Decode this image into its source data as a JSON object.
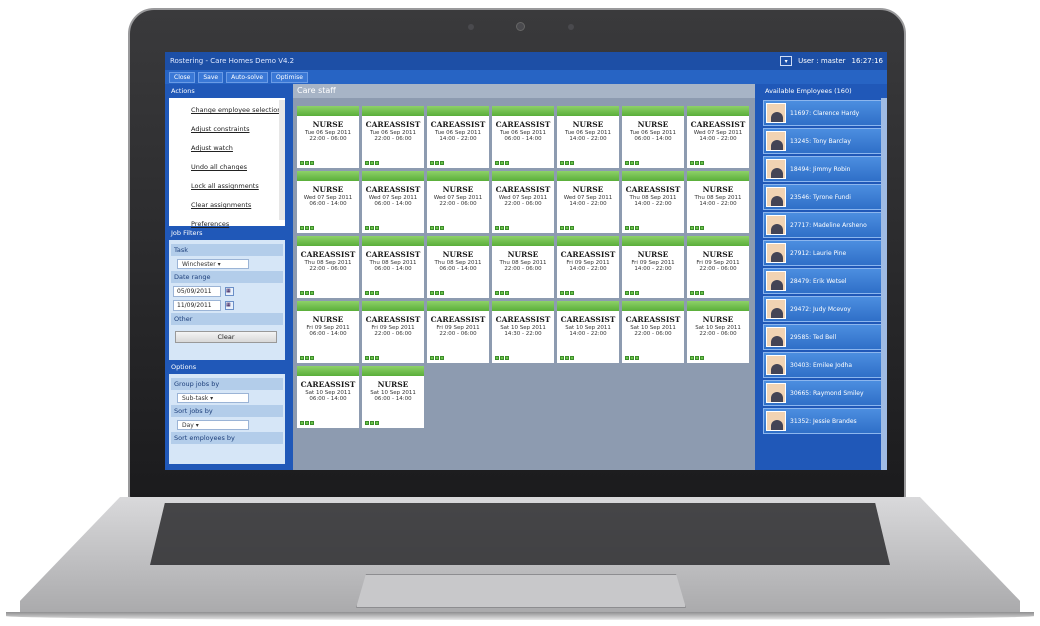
{
  "app": {
    "title": "Rostering - Care Homes Demo V4.2",
    "user": "User : master",
    "clock": "16:27:16"
  },
  "toolbar": [
    "Close",
    "Save",
    "Auto-solve",
    "Optimise"
  ],
  "actions": {
    "title": "Actions",
    "items": [
      "Change employee selection",
      "Adjust constraints",
      "Adjust watch",
      "Undo all changes",
      "Lock all assignments",
      "Clear assignments",
      "Preferences"
    ]
  },
  "filters": {
    "title": "Job Filters",
    "task_label": "Task",
    "task_value": "Winchester",
    "date_label": "Date range",
    "date_from": "05/09/2011",
    "date_to": "11/09/2011",
    "other_label": "Other",
    "clear_label": "Clear"
  },
  "options": {
    "title": "Options",
    "group_label": "Group jobs by",
    "group_value": "Sub-task",
    "sort_jobs_label": "Sort jobs by",
    "sort_jobs_value": "Day",
    "sort_emp_label": "Sort employees by"
  },
  "main": {
    "title": "Care staff",
    "cards": [
      {
        "role": "NURSE",
        "date": "Tue 06 Sep 2011",
        "time": "22:00 - 06:00"
      },
      {
        "role": "CAREASSIST",
        "date": "Tue 06 Sep 2011",
        "time": "22:00 - 06:00"
      },
      {
        "role": "CAREASSIST",
        "date": "Tue 06 Sep 2011",
        "time": "14:00 - 22:00"
      },
      {
        "role": "CAREASSIST",
        "date": "Tue 06 Sep 2011",
        "time": "06:00 - 14:00"
      },
      {
        "role": "NURSE",
        "date": "Tue 06 Sep 2011",
        "time": "14:00 - 22:00"
      },
      {
        "role": "NURSE",
        "date": "Tue 06 Sep 2011",
        "time": "06:00 - 14:00"
      },
      {
        "role": "CAREASSIST",
        "date": "Wed 07 Sep 2011",
        "time": "14:00 - 22:00"
      },
      {
        "role": "NURSE",
        "date": "Wed 07 Sep 2011",
        "time": "06:00 - 14:00"
      },
      {
        "role": "CAREASSIST",
        "date": "Wed 07 Sep 2011",
        "time": "06:00 - 14:00"
      },
      {
        "role": "NURSE",
        "date": "Wed 07 Sep 2011",
        "time": "22:00 - 06:00"
      },
      {
        "role": "CAREASSIST",
        "date": "Wed 07 Sep 2011",
        "time": "22:00 - 06:00"
      },
      {
        "role": "NURSE",
        "date": "Wed 07 Sep 2011",
        "time": "14:00 - 22:00"
      },
      {
        "role": "CAREASSIST",
        "date": "Thu 08 Sep 2011",
        "time": "14:00 - 22:00"
      },
      {
        "role": "NURSE",
        "date": "Thu 08 Sep 2011",
        "time": "14:00 - 22:00"
      },
      {
        "role": "CAREASSIST",
        "date": "Thu 08 Sep 2011",
        "time": "22:00 - 06:00"
      },
      {
        "role": "CAREASSIST",
        "date": "Thu 08 Sep 2011",
        "time": "06:00 - 14:00"
      },
      {
        "role": "NURSE",
        "date": "Thu 08 Sep 2011",
        "time": "06:00 - 14:00"
      },
      {
        "role": "NURSE",
        "date": "Thu 08 Sep 2011",
        "time": "22:00 - 06:00"
      },
      {
        "role": "CAREASSIST",
        "date": "Fri 09 Sep 2011",
        "time": "14:00 - 22:00"
      },
      {
        "role": "NURSE",
        "date": "Fri 09 Sep 2011",
        "time": "14:00 - 22:00"
      },
      {
        "role": "NURSE",
        "date": "Fri 09 Sep 2011",
        "time": "22:00 - 06:00"
      },
      {
        "role": "NURSE",
        "date": "Fri 09 Sep 2011",
        "time": "06:00 - 14:00"
      },
      {
        "role": "CAREASSIST",
        "date": "Fri 09 Sep 2011",
        "time": "22:00 - 06:00"
      },
      {
        "role": "CAREASSIST",
        "date": "Fri 09 Sep 2011",
        "time": "22:00 - 06:00"
      },
      {
        "role": "CAREASSIST",
        "date": "Sat 10 Sep 2011",
        "time": "14:30 - 22:00"
      },
      {
        "role": "CAREASSIST",
        "date": "Sat 10 Sep 2011",
        "time": "14:00 - 22:00"
      },
      {
        "role": "CAREASSIST",
        "date": "Sat 10 Sep 2011",
        "time": "22:00 - 06:00"
      },
      {
        "role": "NURSE",
        "date": "Sat 10 Sep 2011",
        "time": "22:00 - 06:00"
      },
      {
        "role": "CAREASSIST",
        "date": "Sat 10 Sep 2011",
        "time": "06:00 - 14:00"
      },
      {
        "role": "NURSE",
        "date": "Sat 10 Sep 2011",
        "time": "06:00 - 14:00"
      }
    ]
  },
  "employees": {
    "title": "Available Employees (160)",
    "items": [
      "11697: Clarence Hardy",
      "13245: Tony Barclay",
      "18494: Jimmy Robin",
      "23546: Tyrone Fundi",
      "27717: Madeline Arsheno",
      "27912: Laurie Pine",
      "28479: Erik Wetsel",
      "29472: Judy Mcevoy",
      "29585: Ted Bell",
      "30403: Emilee Jodha",
      "30665: Raymond Smiley",
      "31352: Jessie Brandes"
    ]
  }
}
